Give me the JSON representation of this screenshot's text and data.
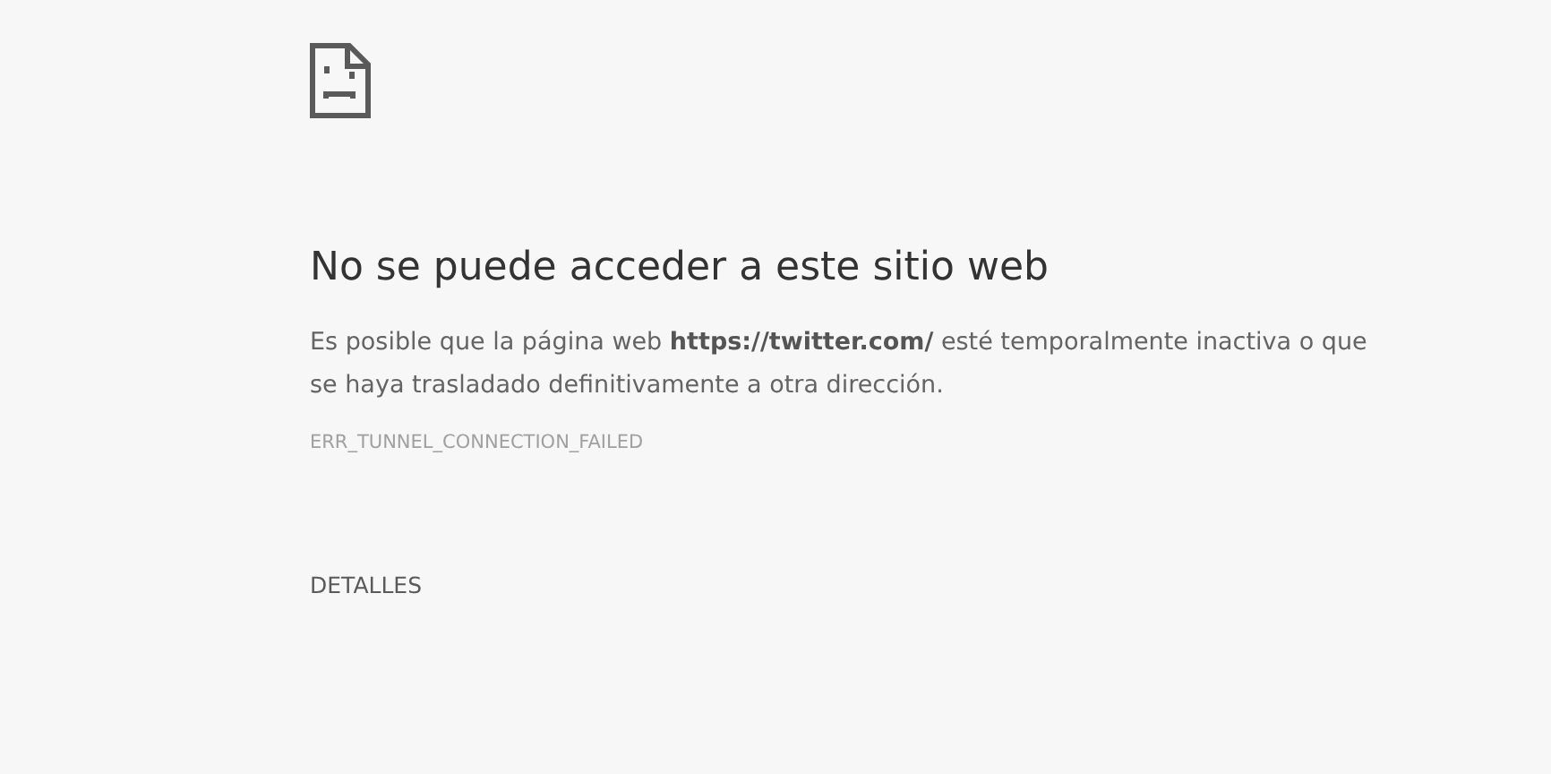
{
  "error_page": {
    "title": "No se puede acceder a este sitio web",
    "message": "Es posible que la página web **https://twitter.com/** esté temporalmente inactiva o que se haya trasladado definitivamente a otra dirección.",
    "error_code": "ERR_TUNNEL_CONNECTION_FAILED",
    "details_button": "DETALLES"
  }
}
